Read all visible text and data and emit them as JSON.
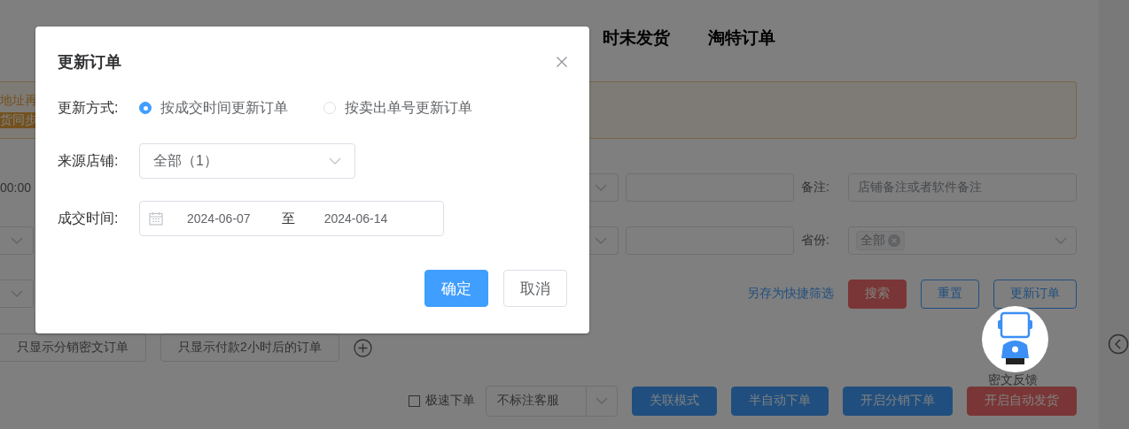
{
  "page": {
    "tabs": [
      {
        "label": "时未发货"
      },
      {
        "label": "淘特订单"
      }
    ],
    "notice": {
      "lines": [
        {
          "text": "地址再",
          "kind": "plain"
        },
        {
          "text": "货同步",
          "kind": "highlight"
        }
      ]
    },
    "filter_row_1": {
      "time_fragment": "00:00",
      "remark_label": "备注:",
      "remark_placeholder": "店铺备注或者软件备注"
    },
    "filter_row_2": {
      "province_label": "省份:",
      "province_tags": [
        "全部"
      ]
    },
    "actions": {
      "save_link": "另存为快捷筛选",
      "buttons": [
        {
          "label": "搜索",
          "kind": "danger"
        },
        {
          "label": "重置",
          "kind": "outline"
        },
        {
          "label": "更新订单",
          "kind": "outline"
        }
      ]
    },
    "quick_filters": [
      "只显示分销密文订单",
      "只显示付款2小时后的订单"
    ],
    "feedback": {
      "label": "密文反馈"
    },
    "bottom_bar": {
      "fast_order": {
        "label": "极速下单",
        "checked": false
      },
      "service_select": "不标注客服",
      "buttons": [
        {
          "label": "关联模式",
          "kind": "primary"
        },
        {
          "label": "半自动下单",
          "kind": "primary"
        },
        {
          "label": "开启分销下单",
          "kind": "primary"
        },
        {
          "label": "开启自动发货",
          "kind": "danger"
        }
      ]
    }
  },
  "dialog": {
    "title": "更新订单",
    "method_label": "更新方式:",
    "methods": [
      {
        "label": "按成交时间更新订单",
        "selected": true
      },
      {
        "label": "按卖出单号更新订单",
        "selected": false
      }
    ],
    "shop_label": "来源店铺:",
    "shop_value": "全部（1）",
    "time_label": "成交时间:",
    "date_start": "2024-06-07",
    "date_separator": "至",
    "date_end": "2024-06-14",
    "buttons": [
      {
        "label": "确定",
        "kind": "primary"
      },
      {
        "label": "取消",
        "kind": "plain"
      }
    ]
  }
}
